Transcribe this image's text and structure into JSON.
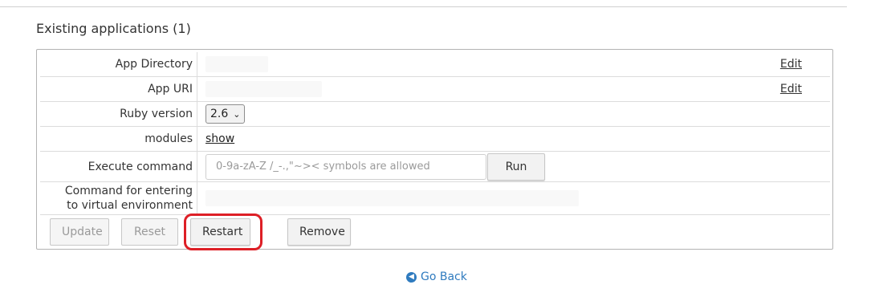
{
  "section": {
    "title": "Existing applications (1)"
  },
  "rows": {
    "app_directory": {
      "label": "App Directory",
      "edit": "Edit"
    },
    "app_uri": {
      "label": "App URI",
      "edit": "Edit"
    },
    "ruby_version": {
      "label": "Ruby version",
      "selected": "2.6"
    },
    "modules": {
      "label": "modules",
      "link": "show"
    },
    "execute_command": {
      "label": "Execute command",
      "placeholder": "0-9a-zA-Z /_-.,\"~>< symbols are allowed",
      "run": "Run"
    },
    "virtual_env": {
      "label_line1": "Command for entering",
      "label_line2": "to virtual environment"
    }
  },
  "actions": {
    "update": "Update",
    "reset": "Reset",
    "restart": "Restart",
    "remove": "Remove"
  },
  "footer": {
    "go_back": "Go Back"
  },
  "colors": {
    "highlight": "#dd1f26",
    "link": "#2f7bbf"
  }
}
